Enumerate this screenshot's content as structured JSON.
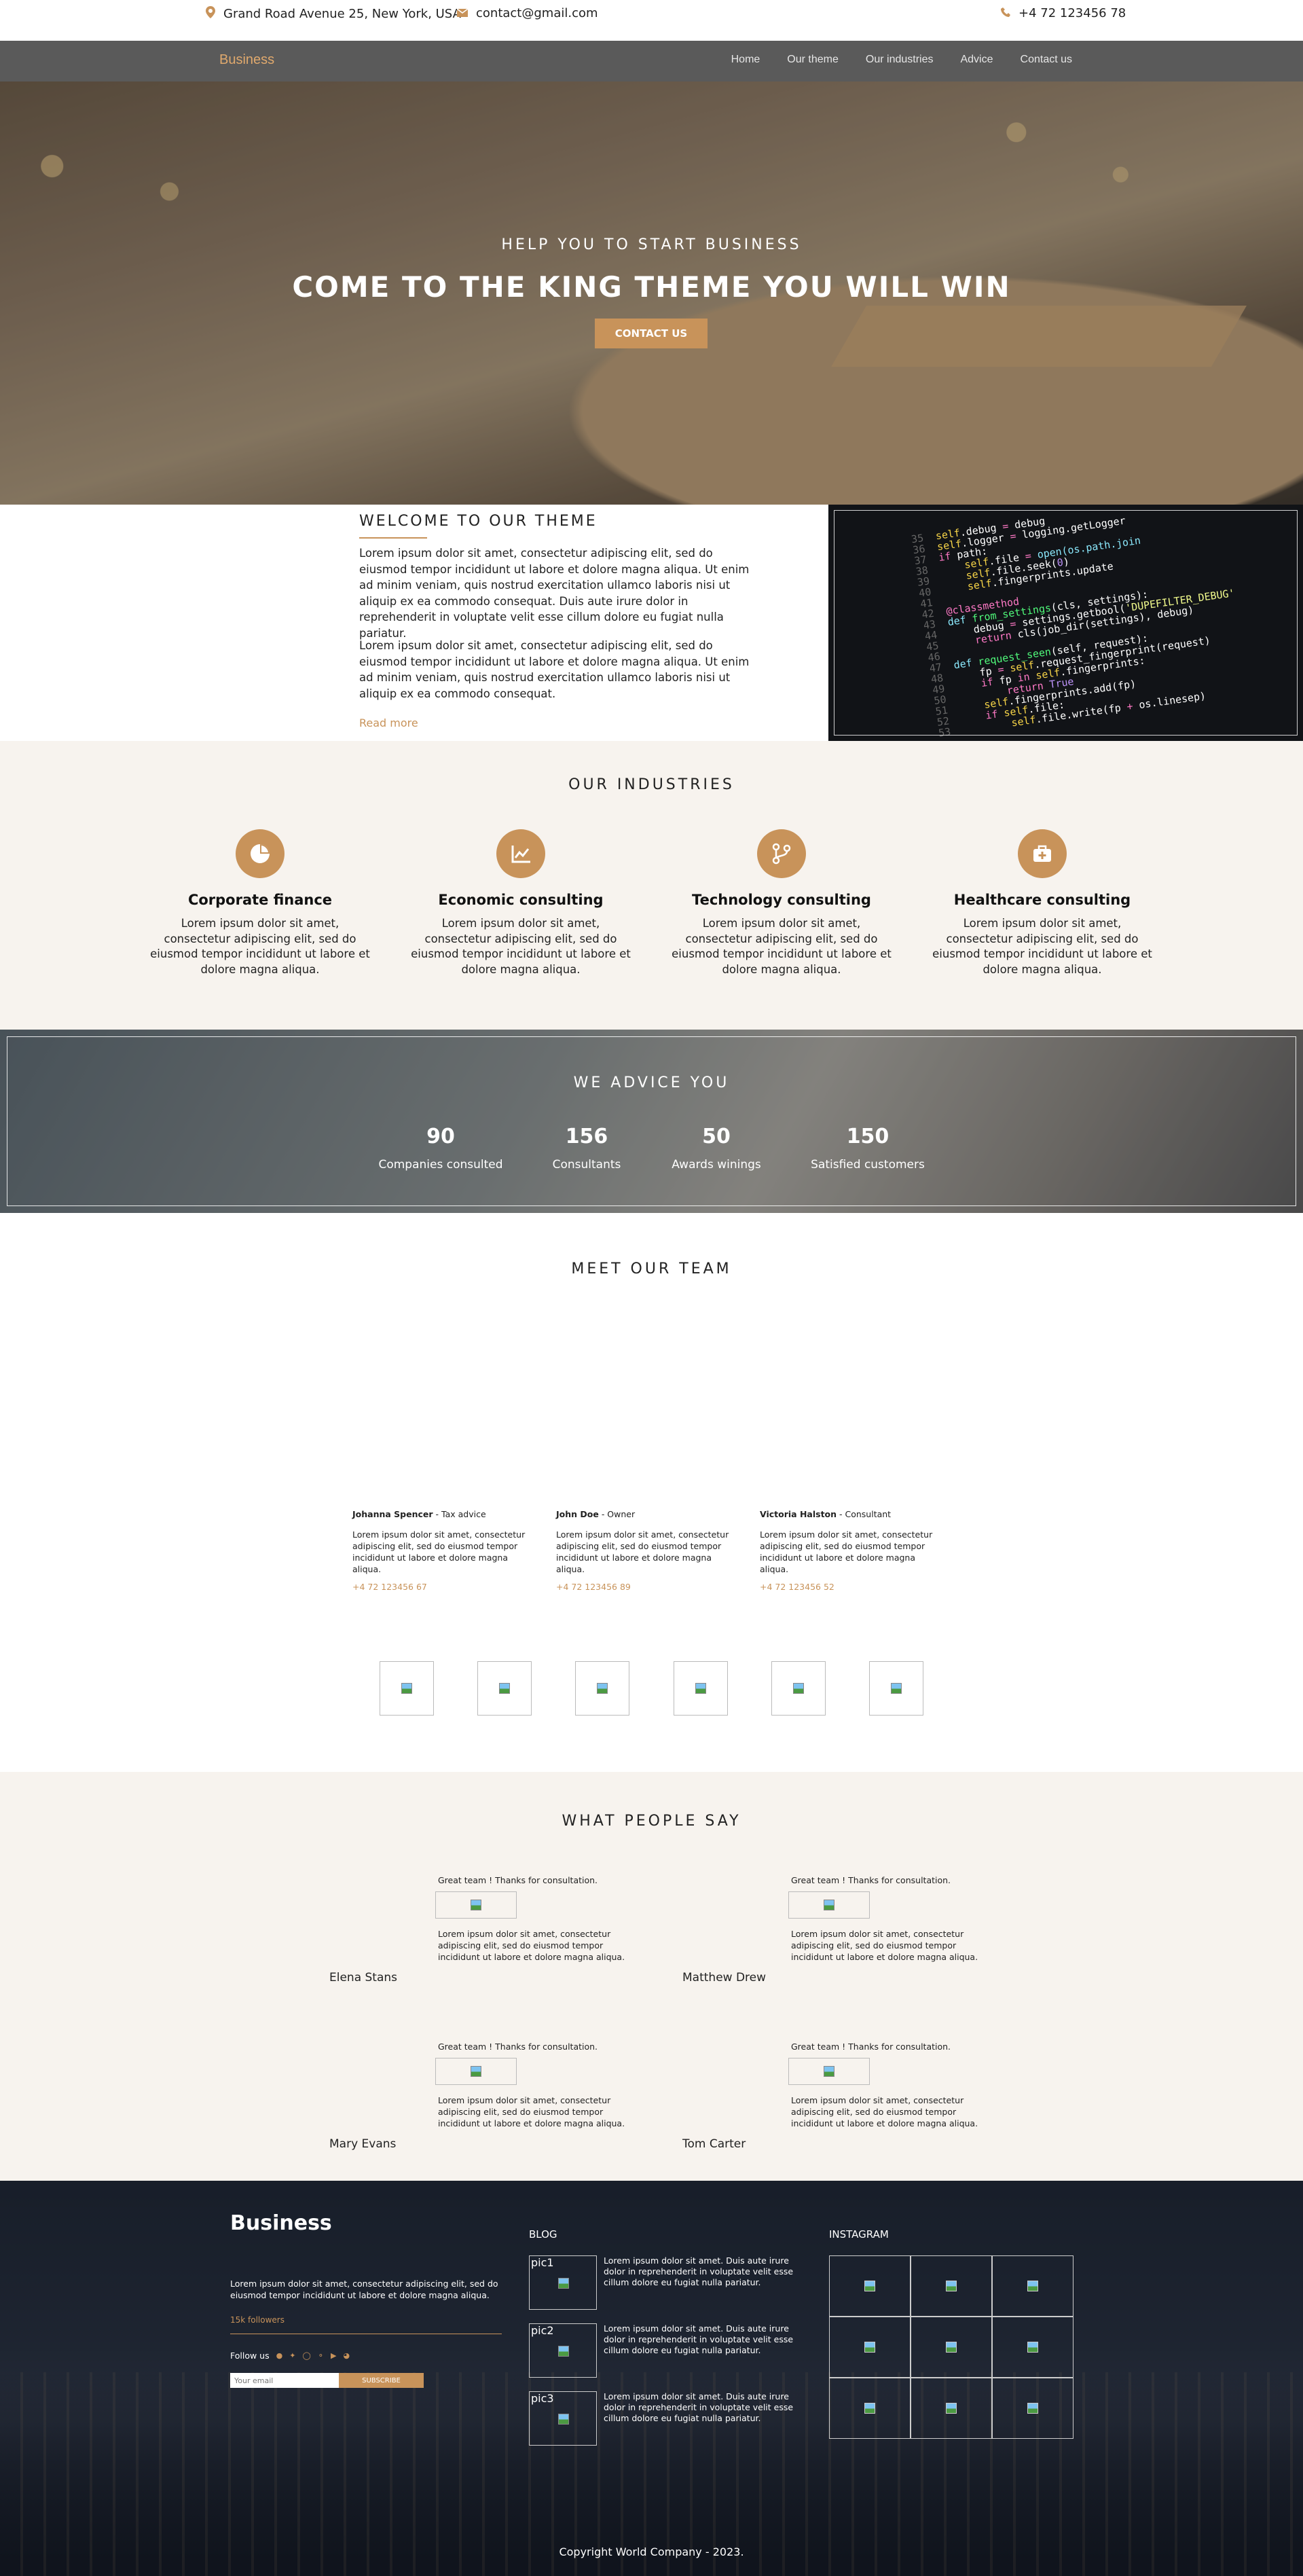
{
  "topbar": {
    "address": "Grand Road Avenue 25, New York, USA",
    "email": "contact@gmail.com",
    "phone": "+4 72 123456 78"
  },
  "nav": {
    "brand": "Business",
    "links": [
      "Home",
      "Our theme",
      "Our industries",
      "Advice",
      "Contact us"
    ]
  },
  "hero": {
    "subtitle": "HELP YOU TO START BUSINESS",
    "title": "COME TO THE KING THEME YOU WILL WIN",
    "cta": "CONTACT US"
  },
  "welcome": {
    "title": "WELCOME TO OUR THEME",
    "p1": "Lorem ipsum dolor sit amet, consectetur adipiscing elit, sed do eiusmod tempor incididunt ut labore et dolore magna aliqua. Ut enim ad minim veniam, quis nostrud exercitation ullamco laboris nisi ut aliquip ex ea commodo consequat. Duis aute irure dolor in reprehenderit in voluptate velit esse cillum dolore eu fugiat nulla pariatur.",
    "p2": "Lorem ipsum dolor sit amet, consectetur adipiscing elit, sed do eiusmod tempor incididunt ut labore et dolore magna aliqua. Ut enim ad minim veniam, quis nostrud exercitation ullamco laboris nisi ut aliquip ex ea commodo consequat.",
    "read_more": "Read more"
  },
  "industries": {
    "title": "OUR INDUSTRIES",
    "items": [
      {
        "name": "Corporate finance",
        "icon": "pie-chart-icon",
        "text": "Lorem ipsum dolor sit amet, consectetur adipiscing elit, sed do eiusmod tempor incididunt ut labore et dolore magna aliqua."
      },
      {
        "name": "Economic consulting",
        "icon": "line-chart-icon",
        "text": "Lorem ipsum dolor sit amet, consectetur adipiscing elit, sed do eiusmod tempor incididunt ut labore et dolore magna aliqua."
      },
      {
        "name": "Technology consulting",
        "icon": "code-branch-icon",
        "text": "Lorem ipsum dolor sit amet, consectetur adipiscing elit, sed do eiusmod tempor incididunt ut labore et dolore magna aliqua."
      },
      {
        "name": "Healthcare consulting",
        "icon": "medical-kit-icon",
        "text": "Lorem ipsum dolor sit amet, consectetur adipiscing elit, sed do eiusmod tempor incididunt ut labore et dolore magna aliqua."
      }
    ]
  },
  "advice": {
    "title": "WE ADVICE YOU",
    "stats": [
      {
        "number": "90",
        "label": "Companies consulted"
      },
      {
        "number": "156",
        "label": "Consultants"
      },
      {
        "number": "50",
        "label": "Awards winings"
      },
      {
        "number": "150",
        "label": "Satisfied customers"
      }
    ]
  },
  "team": {
    "title": "MEET OUR TEAM",
    "members": [
      {
        "name": "Johanna Spencer",
        "role": " - Tax advice",
        "text": "Lorem ipsum dolor sit amet, consectetur adipiscing elit, sed do eiusmod tempor incididunt ut labore et dolore magna aliqua.",
        "phone": "+4 72 123456 67"
      },
      {
        "name": "John Doe",
        "role": " - Owner",
        "text": "Lorem ipsum dolor sit amet, consectetur adipiscing elit, sed do eiusmod tempor incididunt ut labore et dolore magna aliqua.",
        "phone": "+4 72 123456 89"
      },
      {
        "name": "Victoria Halston",
        "role": " - Consultant",
        "text": "Lorem ipsum dolor sit amet, consectetur adipiscing elit, sed do eiusmod tempor incididunt ut labore et dolore magna aliqua.",
        "phone": "+4 72 123456 52"
      }
    ]
  },
  "testimonials": {
    "title": "WHAT PEOPLE SAY",
    "items": [
      {
        "quote": "Great team ! Thanks for consultation.",
        "text": "Lorem ipsum dolor sit amet, consectetur adipiscing elit, sed do eiusmod tempor incididunt ut labore et dolore magna aliqua.",
        "name": "Elena Stans"
      },
      {
        "quote": "Great team ! Thanks for consultation.",
        "text": "Lorem ipsum dolor sit amet, consectetur adipiscing elit, sed do eiusmod tempor incididunt ut labore et dolore magna aliqua.",
        "name": "Matthew Drew"
      },
      {
        "quote": "Great team ! Thanks for consultation.",
        "text": "Lorem ipsum dolor sit amet, consectetur adipiscing elit, sed do eiusmod tempor incididunt ut labore et dolore magna aliqua.",
        "name": "Mary Evans"
      },
      {
        "quote": "Great team ! Thanks for consultation.",
        "text": "Lorem ipsum dolor sit amet, consectetur adipiscing elit, sed do eiusmod tempor incididunt ut labore et dolore magna aliqua.",
        "name": "Tom Carter"
      }
    ]
  },
  "footer": {
    "brand": "Business",
    "about": "Lorem ipsum dolor sit amet, consectetur adipiscing elit, sed do eiusmod tempor incididunt ut labore et dolore magna aliqua.",
    "followers": "15k followers",
    "follow_label": "Follow us",
    "email_placeholder": "Your email",
    "subscribe": "SUBSCRIBE",
    "blog_title": "BLOG",
    "posts": [
      {
        "pic": "pic1",
        "text": "Lorem ipsum dolor sit amet. Duis aute irure dolor in reprehenderit in voluptate velit esse cillum dolore eu fugiat nulla pariatur."
      },
      {
        "pic": "pic2",
        "text": "Lorem ipsum dolor sit amet. Duis aute irure dolor in reprehenderit in voluptate velit esse cillum dolore eu fugiat nulla pariatur."
      },
      {
        "pic": "pic3",
        "text": "Lorem ipsum dolor sit amet. Duis aute irure dolor in reprehenderit in voluptate velit esse cillum dolore eu fugiat nulla pariatur."
      }
    ],
    "instagram_title": "INSTAGRAM",
    "copyright": "Copyright World Company - 2023."
  },
  "colors": {
    "accent": "#c8935a",
    "nav_bg": "#5a5a5a",
    "section_bg": "#f7f3ee"
  }
}
